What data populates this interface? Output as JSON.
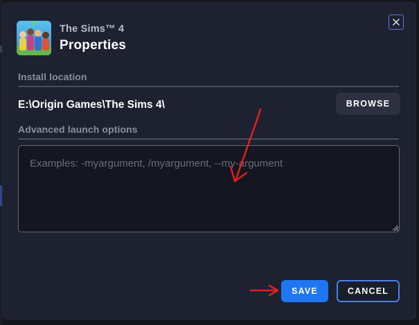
{
  "dialog": {
    "game_name": "The Sims™ 4",
    "title": "Properties",
    "close_icon": "close-icon",
    "game_icon": "game-tile-icon"
  },
  "install": {
    "label": "Install location",
    "path": "E:\\Origin Games\\The Sims 4\\",
    "browse_label": "BROWSE"
  },
  "launch": {
    "label": "Advanced launch options",
    "value": "",
    "placeholder": "Examples: -myargument, /myargument, --my-argument"
  },
  "actions": {
    "save_label": "SAVE",
    "cancel_label": "CANCEL"
  },
  "colors": {
    "accent": "#1f76f3",
    "annotation": "#e02020",
    "background": "#1e2130"
  }
}
